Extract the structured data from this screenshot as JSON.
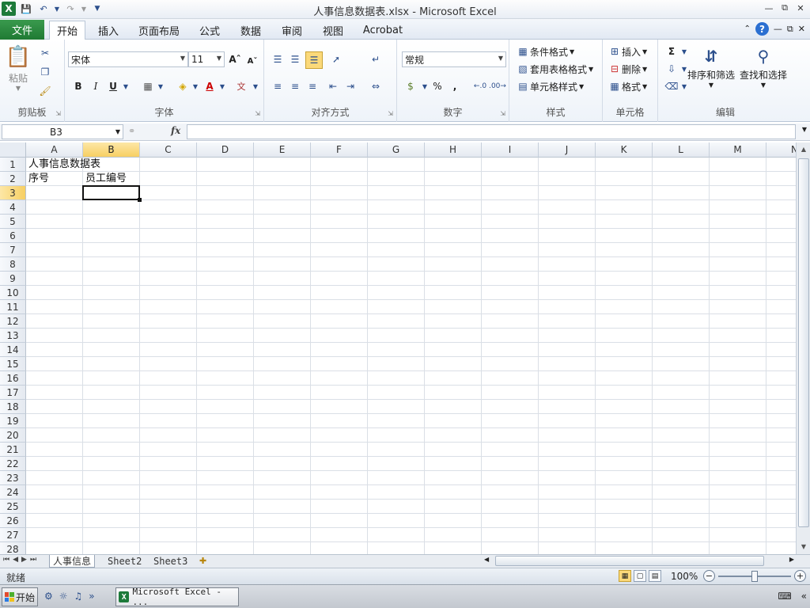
{
  "window": {
    "title": "人事信息数据表.xlsx  -  Microsoft Excel"
  },
  "ribbon_tabs": [
    "开始",
    "插入",
    "页面布局",
    "公式",
    "数据",
    "审阅",
    "视图",
    "Acrobat"
  ],
  "file_tab": "文件",
  "ribbon": {
    "clipboard": {
      "label": "剪贴板",
      "paste": "粘贴"
    },
    "font": {
      "label": "字体",
      "font_name": "宋体",
      "font_size": "11"
    },
    "alignment": {
      "label": "对齐方式"
    },
    "number": {
      "label": "数字",
      "format": "常规",
      "percent": "%",
      "comma": ","
    },
    "styles": {
      "label": "样式",
      "conditional": "条件格式",
      "table_format": "套用表格格式",
      "cell_styles": "单元格样式"
    },
    "cells": {
      "label": "单元格",
      "insert": "插入",
      "delete": "删除",
      "format": "格式"
    },
    "editing": {
      "label": "编辑",
      "sort_filter": "排序和筛选",
      "find_select": "查找和选择"
    }
  },
  "formula_bar": {
    "name_box": "B3",
    "fx": "fx",
    "content": ""
  },
  "columns": [
    "A",
    "B",
    "C",
    "D",
    "E",
    "F",
    "G",
    "H",
    "I",
    "J",
    "K",
    "L",
    "M",
    "N"
  ],
  "selected_column": "B",
  "rows": [
    "1",
    "2",
    "3",
    "4",
    "5",
    "6",
    "7",
    "8",
    "9",
    "10",
    "11",
    "12",
    "13",
    "14",
    "15",
    "16",
    "17",
    "18",
    "19",
    "20",
    "21",
    "22",
    "23",
    "24",
    "25",
    "26",
    "27",
    "28"
  ],
  "selected_row": "3",
  "cells": {
    "A1": "人事信息数据表",
    "A2": "序号",
    "B2": "员工编号"
  },
  "sheet_tabs": [
    "人事信息",
    "Sheet2",
    "Sheet3"
  ],
  "active_sheet": "人事信息",
  "status": {
    "mode": "就绪",
    "zoom": "100%",
    "zoom_level_percent": 100
  },
  "taskbar": {
    "start": "开始",
    "task": "Microsoft Excel - ..."
  },
  "colors": {
    "accent_green": "#1f7a33",
    "selected_header": "#f7cf63"
  }
}
